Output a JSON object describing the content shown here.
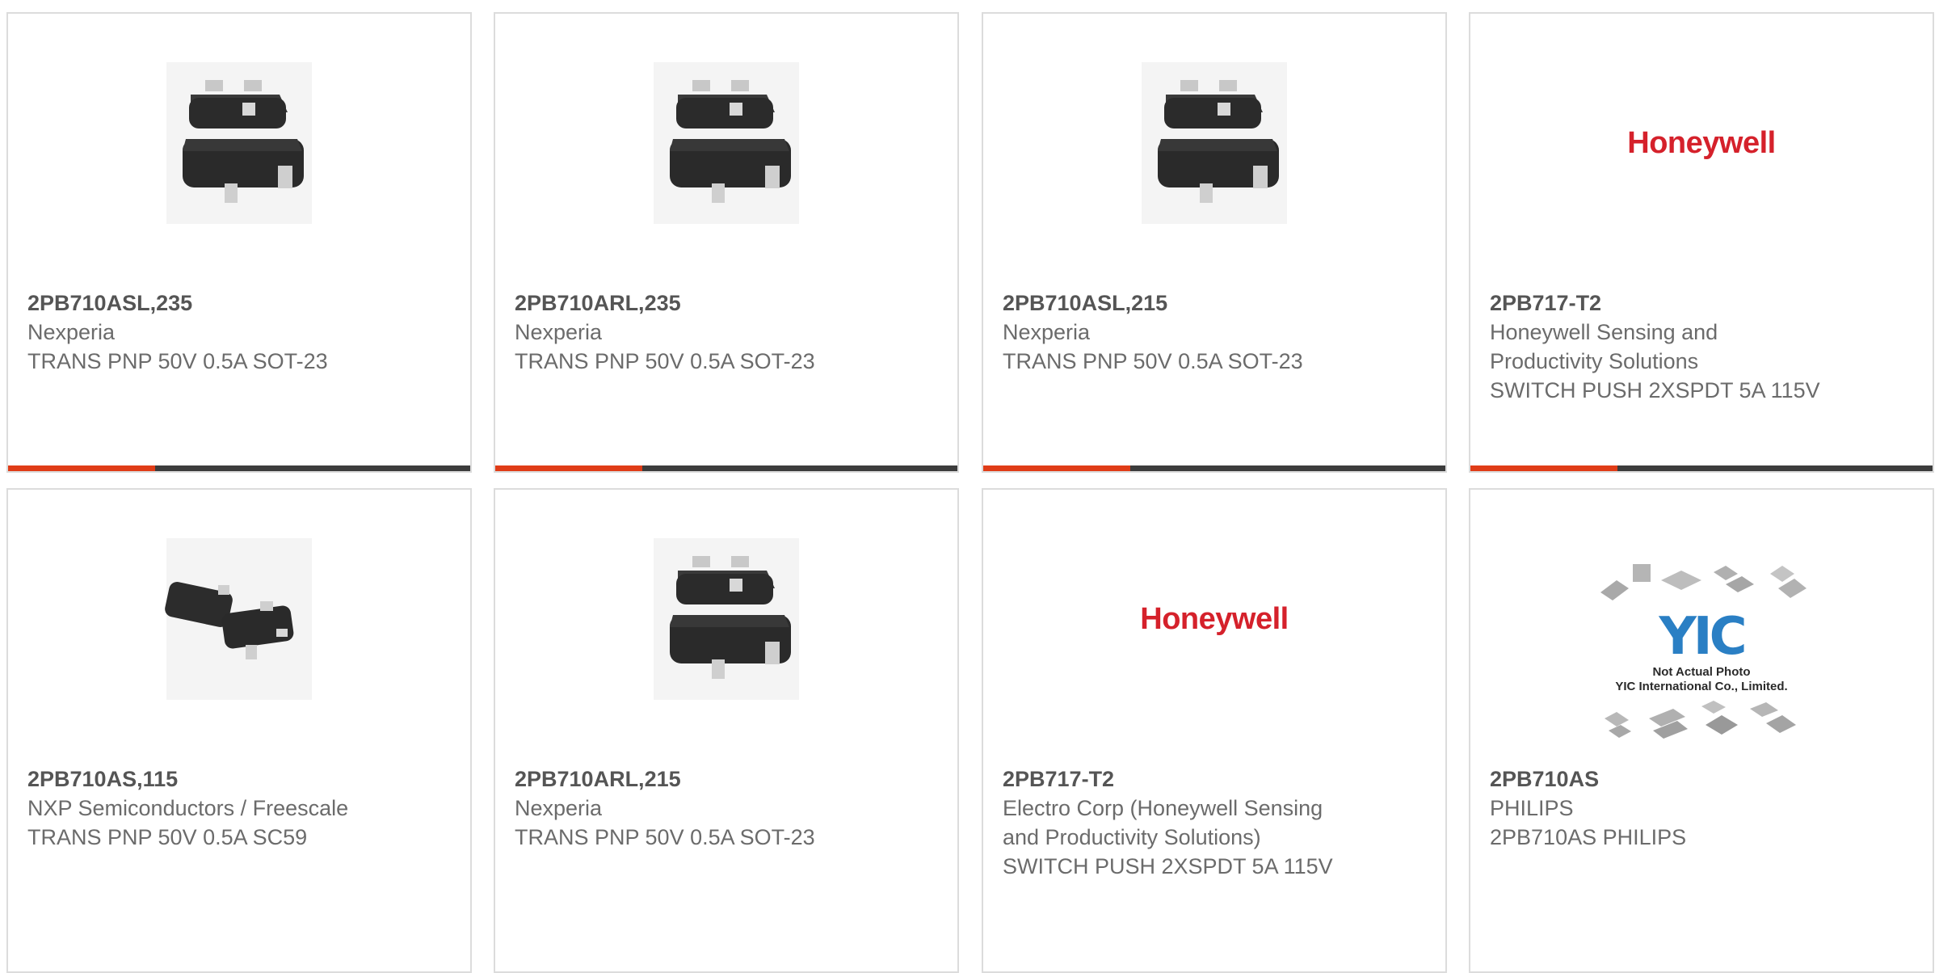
{
  "cards": [
    {
      "part": "2PB710ASL,235",
      "maker": "Nexperia",
      "desc": "TRANS PNP 50V 0.5A SOT-23",
      "image": "sot23-chip"
    },
    {
      "part": "2PB710ARL,235",
      "maker": "Nexperia",
      "desc": "TRANS PNP 50V 0.5A SOT-23",
      "image": "sot23-chip"
    },
    {
      "part": "2PB710ASL,215",
      "maker": "Nexperia",
      "desc": "TRANS PNP 50V 0.5A SOT-23",
      "image": "sot23-chip"
    },
    {
      "part": "2PB717-T2",
      "maker": "Honeywell Sensing and Productivity Solutions",
      "desc": "SWITCH PUSH 2XSPDT 5A 115V",
      "image": "honeywell-logo",
      "logo_text": "Honeywell"
    },
    {
      "part": "2PB710AS,115",
      "maker": "NXP Semiconductors / Freescale",
      "desc": "TRANS PNP 50V 0.5A SC59",
      "image": "sc59-chip"
    },
    {
      "part": "2PB710ARL,215",
      "maker": "Nexperia",
      "desc": "TRANS PNP 50V 0.5A SOT-23",
      "image": "sot23-chip"
    },
    {
      "part": "2PB717-T2",
      "maker": "Electro Corp (Honeywell Sensing and Productivity Solutions)",
      "desc": "SWITCH PUSH 2XSPDT 5A 115V",
      "image": "honeywell-logo",
      "logo_text": "Honeywell"
    },
    {
      "part": "2PB710AS",
      "maker": "PHILIPS",
      "desc": "2PB710AS PHILIPS",
      "image": "not-actual-photo",
      "placeholder_logo": "YIC",
      "placeholder_line1": "Not Actual Photo",
      "placeholder_line2": "YIC International Co., Limited."
    }
  ],
  "colors": {
    "accent": "#e03c17",
    "bar": "#3c3c3c",
    "honeywell_red": "#d5212b",
    "yic_blue": "#2a7fc4"
  }
}
